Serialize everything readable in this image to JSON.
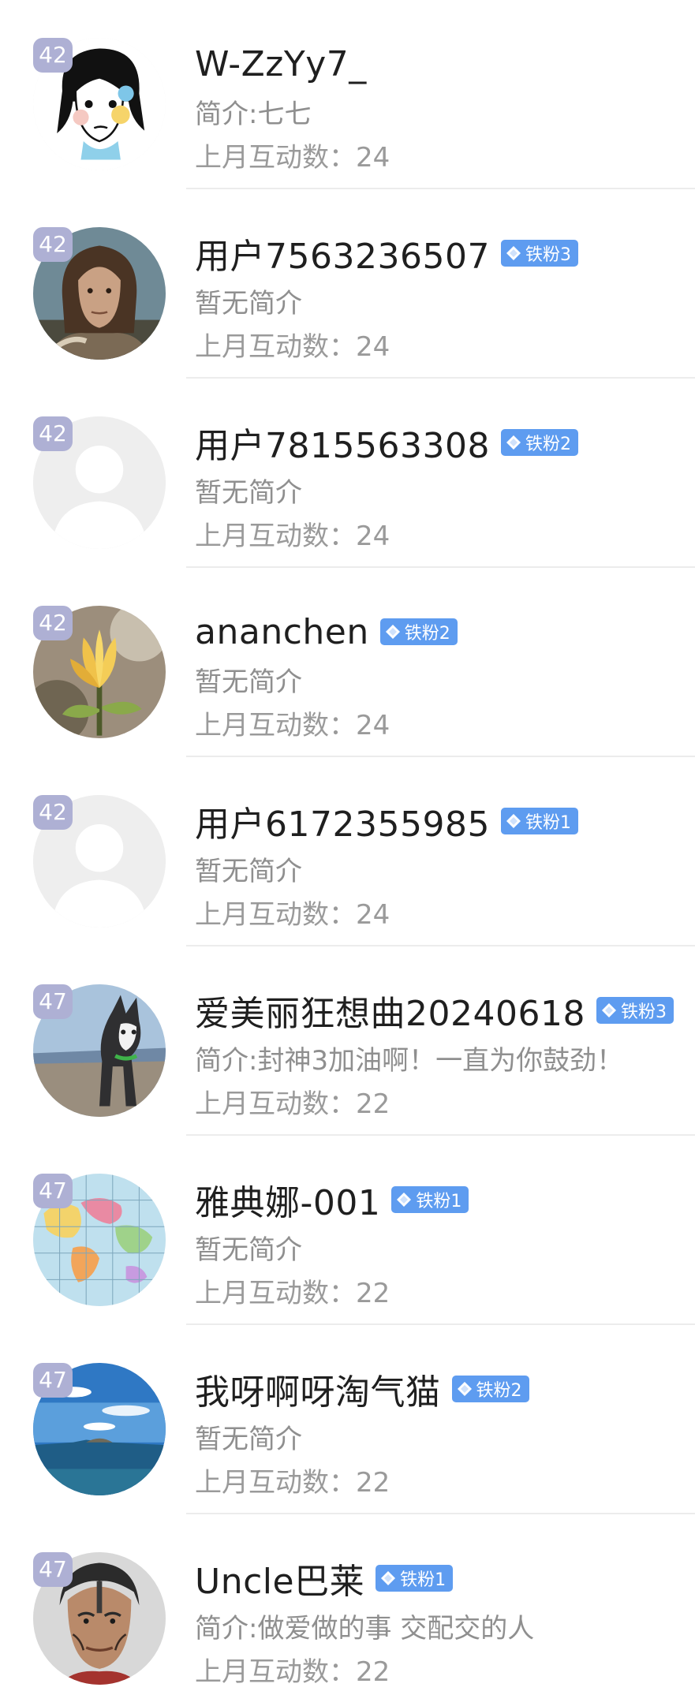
{
  "users": [
    {
      "rank": "42",
      "name": "W-ZzYy7_",
      "badge": "",
      "bio": "简介:七七",
      "stat_label": "上月互动数：",
      "stat_value": "24",
      "avatar": "cartoon-girl"
    },
    {
      "rank": "42",
      "name": "用户7563236507",
      "badge": "铁粉3",
      "bio": "暂无简介",
      "stat_label": "上月互动数：",
      "stat_value": "24",
      "avatar": "man-long-hair"
    },
    {
      "rank": "42",
      "name": "用户7815563308",
      "badge": "铁粉2",
      "bio": "暂无简介",
      "stat_label": "上月互动数：",
      "stat_value": "24",
      "avatar": "default"
    },
    {
      "rank": "42",
      "name": "ananchen",
      "badge": "铁粉2",
      "bio": "暂无简介",
      "stat_label": "上月互动数：",
      "stat_value": "24",
      "avatar": "magnolia-flower"
    },
    {
      "rank": "42",
      "name": "用户6172355985",
      "badge": "铁粉1",
      "bio": "暂无简介",
      "stat_label": "上月互动数：",
      "stat_value": "24",
      "avatar": "default"
    },
    {
      "rank": "47",
      "name": "爱美丽狂想曲20240618",
      "badge": "铁粉3",
      "bio": "简介:封神3加油啊！一直为你鼓劲！",
      "stat_label": "上月互动数：",
      "stat_value": "22",
      "avatar": "husky-dog"
    },
    {
      "rank": "47",
      "name": "雅典娜-001",
      "badge": "铁粉1",
      "bio": "暂无简介",
      "stat_label": "上月互动数：",
      "stat_value": "22",
      "avatar": "world-map"
    },
    {
      "rank": "47",
      "name": "我呀啊呀淘气猫",
      "badge": "铁粉2",
      "bio": "暂无简介",
      "stat_label": "上月互动数：",
      "stat_value": "22",
      "avatar": "sea-sky"
    },
    {
      "rank": "47",
      "name": "Uncle巴莱",
      "badge": "铁粉1",
      "bio": "简介:做爱做的事 交配交的人",
      "stat_label": "上月互动数：",
      "stat_value": "22",
      "avatar": "man-face-paint"
    }
  ],
  "colors": {
    "badge": "#5e9cf0",
    "rank": "#aeb0d4",
    "muted_text": "#8f8f8f"
  }
}
